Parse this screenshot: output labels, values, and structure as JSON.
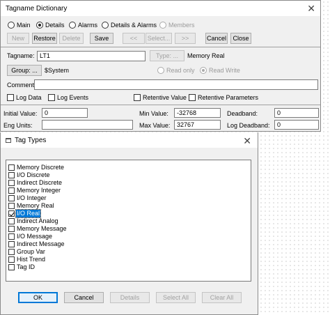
{
  "tagname_dialog": {
    "title": "Tagname Dictionary",
    "modes": [
      {
        "label": "Main",
        "selected": false,
        "enabled": true
      },
      {
        "label": "Details",
        "selected": true,
        "enabled": true
      },
      {
        "label": "Alarms",
        "selected": false,
        "enabled": true
      },
      {
        "label": "Details & Alarms",
        "selected": false,
        "enabled": true
      },
      {
        "label": "Members",
        "selected": false,
        "enabled": false
      }
    ],
    "toolbar": {
      "new": "New",
      "restore": "Restore",
      "delete": "Delete",
      "save": "Save",
      "prev": "<<",
      "select": "Select...",
      "next": ">>",
      "cancel": "Cancel",
      "close": "Close"
    },
    "tagname_label": "Tagname:",
    "tagname_value": "LT1",
    "type_button": "Type: ...",
    "type_value": "Memory Real",
    "group_button": "Group: ...",
    "group_value": "$System",
    "read_only_label": "Read only",
    "read_write_label": "Read Write",
    "comment_label": "Comment:",
    "comment_value": "",
    "log_data_label": "Log Data",
    "log_events_label": "Log Events",
    "retentive_value_label": "Retentive Value",
    "retentive_params_label": "Retentive Parameters",
    "initial_value_label": "Initial Value:",
    "initial_value": "0",
    "min_value_label": "Min Value:",
    "min_value": "-32768",
    "deadband_label": "Deadband:",
    "deadband_value": "0",
    "eng_units_label": "Eng Units:",
    "eng_units_value": "",
    "max_value_label": "Max Value:",
    "max_value": "32767",
    "log_deadband_label": "Log Deadband:",
    "log_deadband_value": "0"
  },
  "tag_types_dialog": {
    "title": "Tag Types",
    "close_glyph": "✕",
    "items": [
      {
        "label": "Memory Discrete",
        "checked": false,
        "selected": false
      },
      {
        "label": "I/O Discrete",
        "checked": false,
        "selected": false
      },
      {
        "label": "Indirect Discrete",
        "checked": false,
        "selected": false
      },
      {
        "label": "Memory Integer",
        "checked": false,
        "selected": false
      },
      {
        "label": "I/O Integer",
        "checked": false,
        "selected": false
      },
      {
        "label": "Memory Real",
        "checked": false,
        "selected": false
      },
      {
        "label": "I/O Real",
        "checked": true,
        "selected": true
      },
      {
        "label": "Indirect Analog",
        "checked": false,
        "selected": false
      },
      {
        "label": "Memory Message",
        "checked": false,
        "selected": false
      },
      {
        "label": "I/O Message",
        "checked": false,
        "selected": false
      },
      {
        "label": "Indirect Message",
        "checked": false,
        "selected": false
      },
      {
        "label": "Group Var",
        "checked": false,
        "selected": false
      },
      {
        "label": "Hist Trend",
        "checked": false,
        "selected": false
      },
      {
        "label": "Tag ID",
        "checked": false,
        "selected": false
      }
    ],
    "buttons": {
      "ok": "OK",
      "cancel": "Cancel",
      "details": "Details",
      "select_all": "Select All",
      "clear_all": "Clear All"
    }
  }
}
